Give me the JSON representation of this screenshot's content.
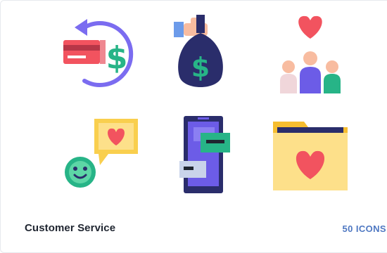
{
  "card": {
    "title": "Customer Service",
    "count_label": "50 ICONS"
  },
  "icons": [
    "card-refund-icon",
    "money-bag-icon",
    "customer-love-icon",
    "happy-chat-icon",
    "mobile-chat-icon",
    "favorite-folder-icon"
  ],
  "colors": {
    "title": "#1f2530",
    "count": "#4f78c2",
    "red": "#f2535f",
    "green": "#27b487",
    "purple": "#6c5ce7",
    "yellow": "#f9cf4e",
    "navy": "#2a2d6b"
  }
}
